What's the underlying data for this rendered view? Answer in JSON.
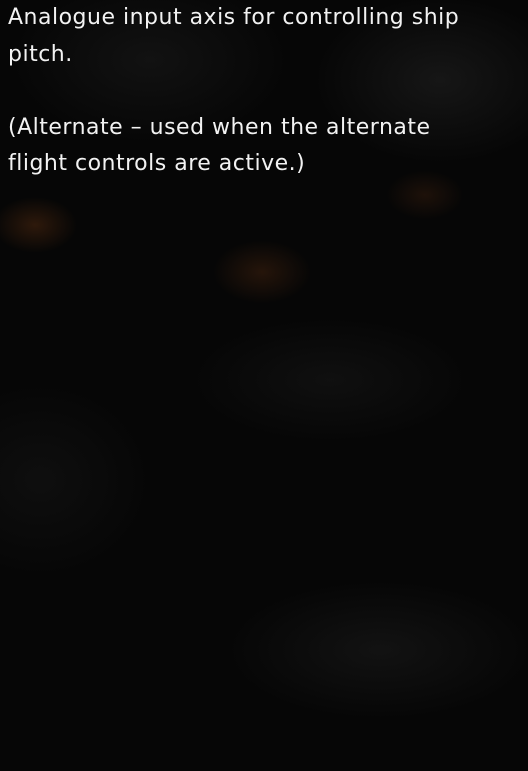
{
  "description": {
    "line1": "Analogue input axis for controlling ship",
    "line2": "pitch.",
    "line3": "(Alternate – used when the alternate",
    "line4": "flight controls are active.)"
  }
}
